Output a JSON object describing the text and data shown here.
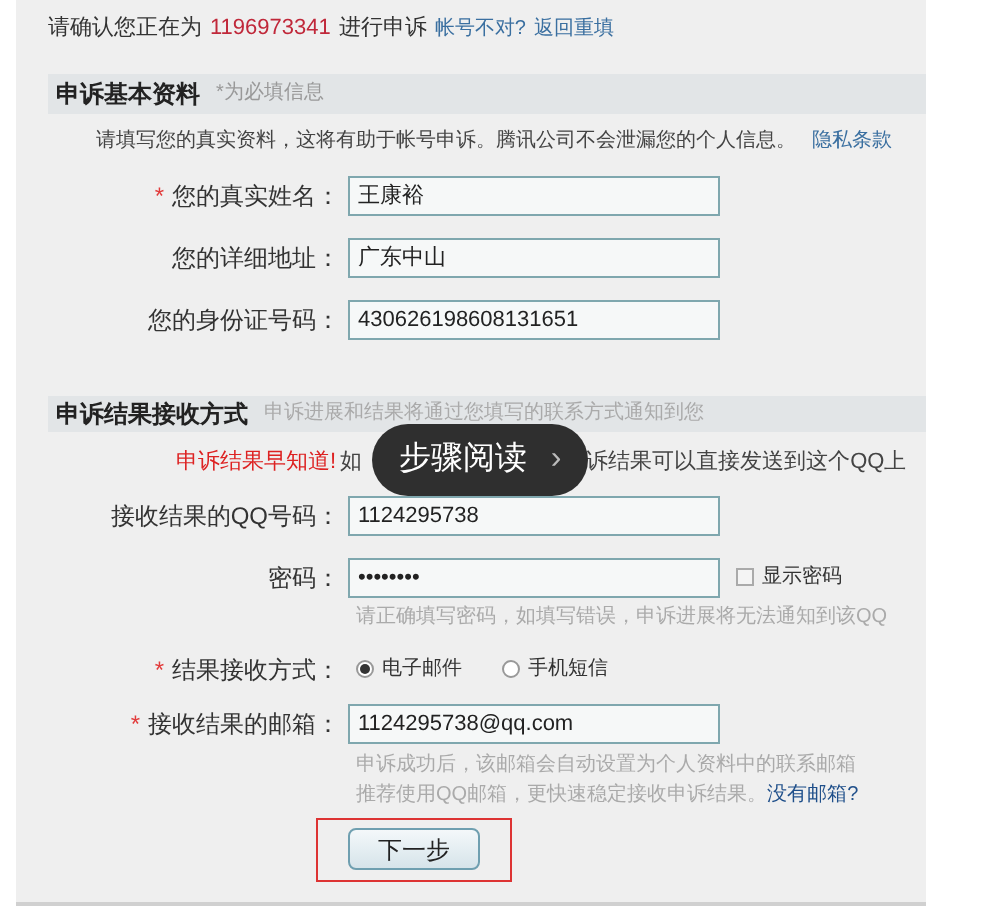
{
  "confirm_line": {
    "prefix": "请确认您正在为",
    "account": "1196973341",
    "suffix": "进行申诉",
    "wrong_account": "帐号不对?",
    "go_back": "返回重填"
  },
  "basic_section": {
    "title": "申诉基本资料",
    "required_note": "*为必填信息",
    "intro": "请填写您的真实资料，这将有助于帐号申诉。腾讯公司不会泄漏您的个人信息。",
    "privacy_link": "隐私条款",
    "fields": [
      {
        "label": "您的真实姓名：",
        "value": "王康裕",
        "required_mark": "*"
      },
      {
        "label": "您的详细地址：",
        "value": "广东中山"
      },
      {
        "label": "您的身份证号码：",
        "value": "430626198608131651"
      }
    ]
  },
  "result_section": {
    "title": "申诉结果接收方式",
    "subtitle": "申诉进展和结果将通过您填写的联系方式通知到您",
    "notice_title": "申诉结果早知道!",
    "notice_before": "如",
    "notice_after": "诉结果可以直接发送到这个QQ上",
    "qq": {
      "label": "接收结果的QQ号码：",
      "value": "1124295738"
    },
    "password": {
      "label": "密码：",
      "value": "••••••••",
      "show_password": {
        "label": "显示密码",
        "checked": false
      },
      "hint": "请正确填写密码，如填写错误，申诉进展将无法通知到该QQ"
    },
    "method": {
      "label": "结果接收方式：",
      "required_mark": "*",
      "options": [
        {
          "label": "电子邮件",
          "selected": true
        },
        {
          "label": "手机短信",
          "selected": false
        }
      ]
    },
    "email": {
      "label": "接收结果的邮箱：",
      "required_mark": "*",
      "value": "1124295738@qq.com",
      "note_1": "申诉成功后，该邮箱会自动设置为个人资料中的联系邮箱",
      "note_2": "推荐使用QQ邮箱，更快速稳定接收申诉结果。",
      "no_email_link": "没有邮箱?"
    }
  },
  "next_button": "下一步",
  "overlay": {
    "label": "步骤阅读",
    "arrow": "›"
  }
}
